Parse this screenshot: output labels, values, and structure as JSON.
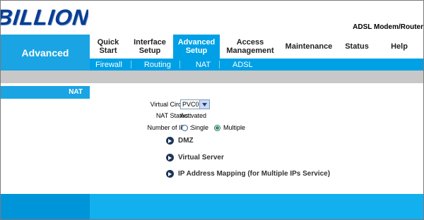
{
  "header": {
    "logo": "BILLION",
    "product": "ADSL Modem/Router"
  },
  "section": "Advanced",
  "tabs": [
    {
      "label": "Quick\nStart",
      "active": false
    },
    {
      "label": "Interface\nSetup",
      "active": false
    },
    {
      "label": "Advanced\nSetup",
      "active": true
    },
    {
      "label": "Access\nManagement",
      "active": false
    },
    {
      "label": "Maintenance",
      "active": false
    },
    {
      "label": "Status",
      "active": false
    },
    {
      "label": "Help",
      "active": false
    }
  ],
  "subtabs": [
    "Firewall",
    "Routing",
    "NAT",
    "ADSL"
  ],
  "leftnav": {
    "active": "NAT"
  },
  "form": {
    "virtual_circuit_label": "Virtual Circuit :",
    "virtual_circuit_value": "PVC0",
    "nat_status_label": "NAT Status :",
    "nat_status_value": "Activated",
    "number_of_ips_label": "Number of IPs :",
    "option_single": "Single",
    "option_multiple": "Multiple",
    "selected_option": "Multiple"
  },
  "links": {
    "dmz": "DMZ",
    "virtual_server": "Virtual Server",
    "ip_mapping": "IP Address Mapping (for Multiple IPs Service)"
  },
  "colors": {
    "accent_blue": "#00a0e6",
    "logo_blue": "#0a3d91"
  }
}
